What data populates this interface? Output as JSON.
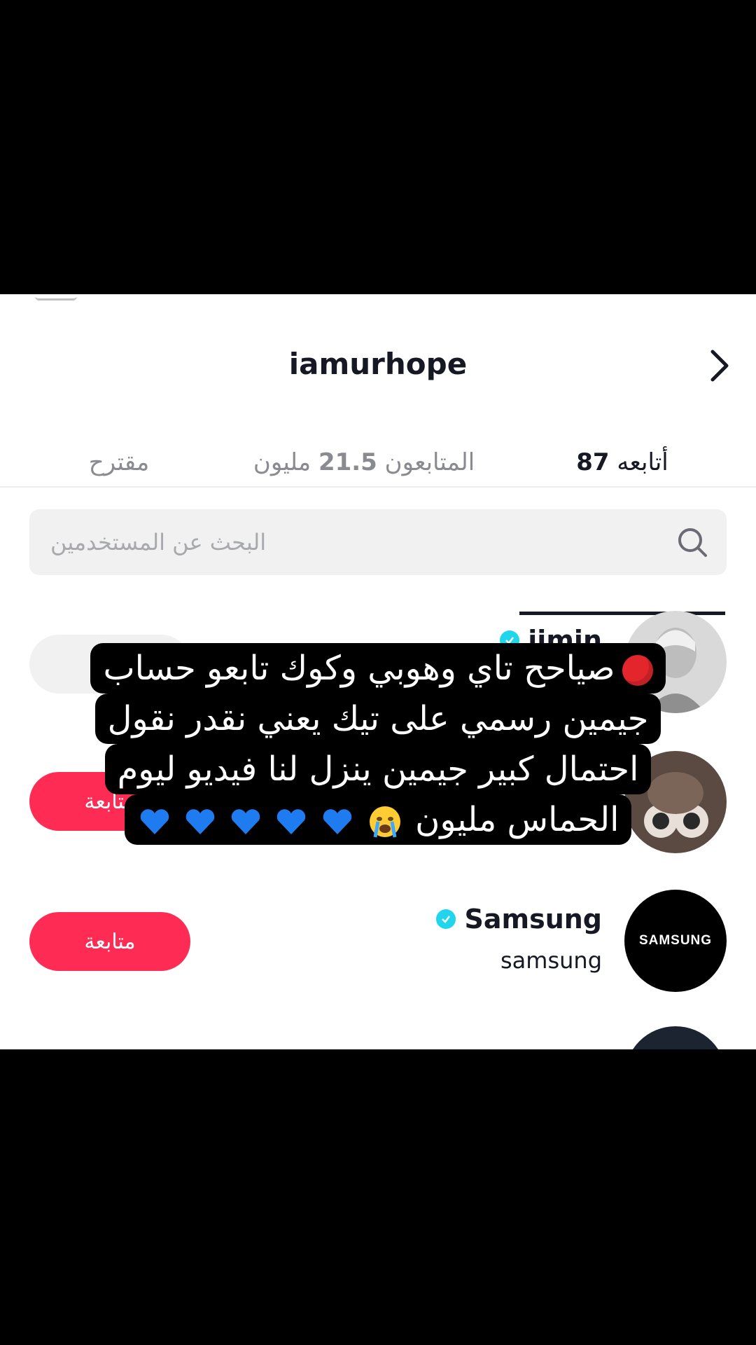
{
  "header": {
    "username": "iamurhope"
  },
  "tabs": [
    {
      "id": "following",
      "label": "أتابعه",
      "count": "87",
      "active": true
    },
    {
      "id": "followers",
      "label": "المتابعون",
      "count": "21.5",
      "suffix": "مليون",
      "active": false
    },
    {
      "id": "suggested",
      "label": "مقترح",
      "active": false
    }
  ],
  "search": {
    "placeholder": "البحث عن المستخدمين"
  },
  "users": [
    {
      "display_name": "jimin",
      "username": "",
      "verified": true,
      "button": ""
    },
    {
      "display_name": "",
      "username": "",
      "verified": false,
      "button": "متابعة"
    },
    {
      "display_name": "Samsung",
      "username": "samsung",
      "verified": true,
      "button": "متابعة",
      "avatar_text": "SAMSUNG"
    }
  ],
  "caption": {
    "lines": [
      "صياحح تاي وهوبي وكوك تابعو حساب",
      "جيمين رسمي على تيك يعني نقدر نقول",
      "احتمال كبير جيمين ينزل لنا فيديو ليوم",
      "الحماس مليون"
    ]
  },
  "colors": {
    "accent": "#fe2c55",
    "verified": "#20d5ec",
    "text": "#161823"
  }
}
